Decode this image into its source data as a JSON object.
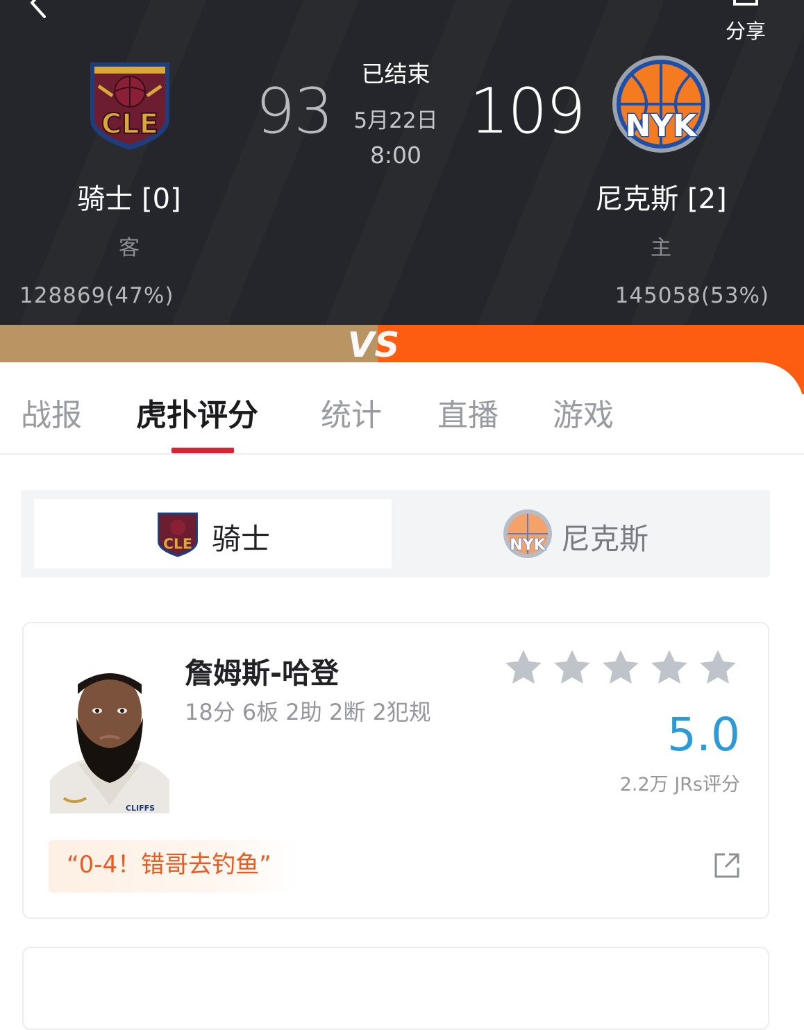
{
  "header": {
    "share_label": "分享",
    "status": "已结束",
    "date": "5月22日",
    "time": "8:00",
    "away": {
      "logo_text": "CLE",
      "name": "骑士 [0]",
      "score": "93",
      "role": "客",
      "votes": "128869(47%)",
      "vote_share": 0.47
    },
    "home": {
      "logo_text": "NYK",
      "name": "尼克斯 [2]",
      "score": "109",
      "role": "主",
      "votes": "145058(53%)",
      "vote_share": 0.53
    }
  },
  "vs_bar": {
    "text": "VS",
    "left_color": "#b99564",
    "right_color": "#fd5d11"
  },
  "tabs": [
    {
      "label": "战报",
      "active": false
    },
    {
      "label": "虎扑评分",
      "active": true
    },
    {
      "label": "统计",
      "active": false
    },
    {
      "label": "直播",
      "active": false
    },
    {
      "label": "游戏",
      "active": false
    }
  ],
  "team_switch": {
    "selected": {
      "label": "骑士",
      "logo_text": "CLE"
    },
    "other": {
      "label": "尼克斯",
      "logo_text": "NYK"
    }
  },
  "player": {
    "name": "詹姆斯-哈登",
    "stats": "18分 6板 2助 2断 2犯规",
    "rating": "5.0",
    "stars_filled": 0,
    "stars_total": 5,
    "rating_count": "2.2万 JRs评分",
    "jersey_text": "CLIFFS",
    "quote": "“0-4！错哥去钓鱼”"
  },
  "colors": {
    "header_bg": "#25262b",
    "tab_indicator": "#e0202f",
    "rating_blue": "#2b9bd8",
    "quote_orange": "#e85a20",
    "star_gray": "#bfc3ca"
  },
  "icons": {
    "back": "chevron-left-icon",
    "share": "share-icon",
    "star": "star-icon",
    "external": "external-link-icon"
  }
}
